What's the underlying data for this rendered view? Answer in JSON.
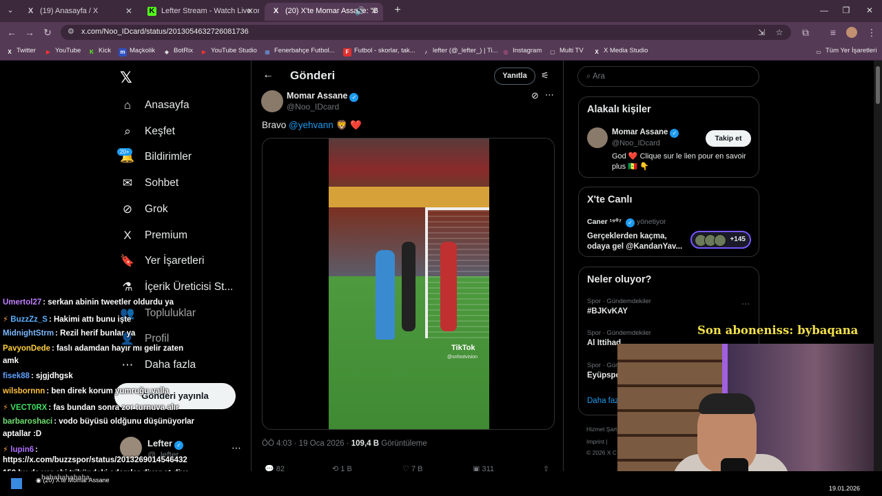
{
  "browser": {
    "tabs": [
      {
        "label": "(19) Anasayfa / X",
        "icon": "X",
        "active": false
      },
      {
        "label": "Lefter Stream - Watch Live on K",
        "icon": "K",
        "active": false
      },
      {
        "label": "(20) X'te Momar Assane: \"B",
        "icon": "X",
        "active": true
      }
    ],
    "url": "x.com/Noo_IDcard/status/2013054632726081736",
    "bookmarks": [
      {
        "label": "Twitter",
        "icon": "X",
        "color": "#000000"
      },
      {
        "label": "YouTube",
        "icon": "▶",
        "color": "#ff0000"
      },
      {
        "label": "Kick",
        "icon": "K",
        "color": "#53fc18"
      },
      {
        "label": "Maçkolik",
        "icon": "m",
        "color": "#3050c0"
      },
      {
        "label": "BotRix",
        "icon": "◆",
        "color": "#dddddd"
      },
      {
        "label": "YouTube Studio",
        "icon": "▶",
        "color": "#ff0000"
      },
      {
        "label": "Fenerbahçe Futbol...",
        "icon": "▦",
        "color": "#2050a0"
      },
      {
        "label": "Futbol - skorlar, tak...",
        "icon": "F",
        "color": "#e03030"
      },
      {
        "label": "lefter (@_lefter_) | Ti...",
        "icon": "♪",
        "color": "#000000"
      },
      {
        "label": "Instagram",
        "icon": "◎",
        "color": "#d03080"
      },
      {
        "label": "Multi TV",
        "icon": "▢",
        "color": "#555555"
      },
      {
        "label": "X Media Studio",
        "icon": "X",
        "color": "#000000"
      },
      {
        "label": "Tüm Yer İşaretleri",
        "icon": "▭",
        "color": "transparent"
      }
    ]
  },
  "x": {
    "nav": [
      {
        "label": "Anasayfa",
        "icon": "⌂"
      },
      {
        "label": "Keşfet",
        "icon": "⌕"
      },
      {
        "label": "Bildirimler",
        "icon": "🔔"
      },
      {
        "label": "Sohbet",
        "icon": "✉"
      },
      {
        "label": "Grok",
        "icon": "⊘"
      },
      {
        "label": "Premium",
        "icon": "X"
      },
      {
        "label": "Yer İşaretleri",
        "icon": "🔖"
      },
      {
        "label": "İçerik Üreticisi St...",
        "icon": "⚗"
      },
      {
        "label": "Topluluklar",
        "icon": "👥"
      },
      {
        "label": "Profil",
        "icon": "👤"
      },
      {
        "label": "Daha fazla",
        "icon": "⋯"
      }
    ],
    "notif_badge": "20+",
    "post_button": "Gönderi yayınla",
    "account": {
      "name": "Lefter",
      "handle": "@_lefter_"
    },
    "header_title": "Gönderi",
    "reply_pill": "Yanıtla",
    "tweet": {
      "author": "Momar Assane",
      "handle": "@Noo_IDcard",
      "text": "Bravo ",
      "mention": "@yehvann",
      "emojis": "🦁 ❤️",
      "watermark": "TikTok",
      "watermark_sub": "@snfootvision",
      "time": "ÖÖ 4:03 · 19 Oca 2026 · ",
      "views": "109,4 B",
      "views_label": "Görüntüleme",
      "actions": [
        {
          "icon": "💬",
          "count": "82"
        },
        {
          "icon": "⟲",
          "count": "1 B"
        },
        {
          "icon": "♡",
          "count": "7 B"
        },
        {
          "icon": "▣",
          "count": "311"
        },
        {
          "icon": "⇧",
          "count": ""
        }
      ]
    },
    "search_placeholder": "Ara",
    "relevant": {
      "title": "Alakalı kişiler",
      "name": "Momar Assane",
      "handle": "@Noo_IDcard",
      "follow": "Takip et",
      "bio": "God ❤️ Clique sur le lien pour en savoir plus 🇸🇳 👇"
    },
    "live": {
      "title": "X'te Canlı",
      "host": "Caner ¹⁹⁰⁷",
      "host_suffix": "yönetiyor",
      "text": "Gerçeklerden kaçma, odaya gel @KandanYav...",
      "count": "+145"
    },
    "trends": {
      "title": "Neler oluyor?",
      "items": [
        {
          "context": "Spor · Gündemdekiler",
          "topic": "#BJKvKAY"
        },
        {
          "context": "Spor · Gündemdekiler",
          "topic": "Al Ittihad"
        },
        {
          "context": "Spor · Gün",
          "topic": "Eyüpspo"
        }
      ],
      "show_more": "Daha faz"
    },
    "footer": [
      "Hizmet Şart",
      "Imprint  |",
      "© 2026 X C"
    ]
  },
  "stream": {
    "sub_alert": "Son aboneniss: bybaqana",
    "chat": [
      {
        "user": "Umertol27",
        "color": "#c080ff",
        "msg": ": serkan abinin tweetler oldurdu ya"
      },
      {
        "user": "BuzzZz_S",
        "color": "#5ab0ff",
        "msg": ": Hakimi attı bunu işte",
        "badge": true
      },
      {
        "user": "MidnightStrm",
        "color": "#7ab8ff",
        "msg": ": Rezil herif bunlar ya"
      },
      {
        "user": "PavyonDede",
        "color": "#ffd040",
        "msg": ": faslı adamdan hayır mı gelir zaten"
      },
      {
        "user": "",
        "color": "#ffffff",
        "msg": "amk"
      },
      {
        "user": "fisek88",
        "color": "#60a0ff",
        "msg": ": sjgjdhgsk"
      },
      {
        "user": "wilsbornnn",
        "color": "#ffc040",
        "msg": ": ben direk korum yumruğu valla"
      },
      {
        "user": "VECT0RX",
        "color": "#40e060",
        "msg": ": fas bundan sonra zor turnuva alır",
        "badge": true
      },
      {
        "user": "barbaroshaci",
        "color": "#70e070",
        "msg": ": vodo büyüsü oldğunu düşünüyorlar"
      },
      {
        "user": "",
        "color": "#ffffff",
        "msg": "aptallar :D"
      },
      {
        "user": "lupin6",
        "color": "#b070ff",
        "msg": ":",
        "badge": true
      },
      {
        "user": "",
        "color": "#ffffff",
        "msg": "https://x.com/buzzspor/status/2013269014546432"
      },
      {
        "user": "",
        "color": "#ffffff",
        "msg": "150 bu da var abi tribündeki adamlar diyor at diye"
      },
      {
        "user": "",
        "color": "#ffffff",
        "msg": "hahahahahaha"
      }
    ]
  },
  "taskbar": {
    "app": "(20) X'te Momar Assane",
    "date": "19.01.2026"
  }
}
